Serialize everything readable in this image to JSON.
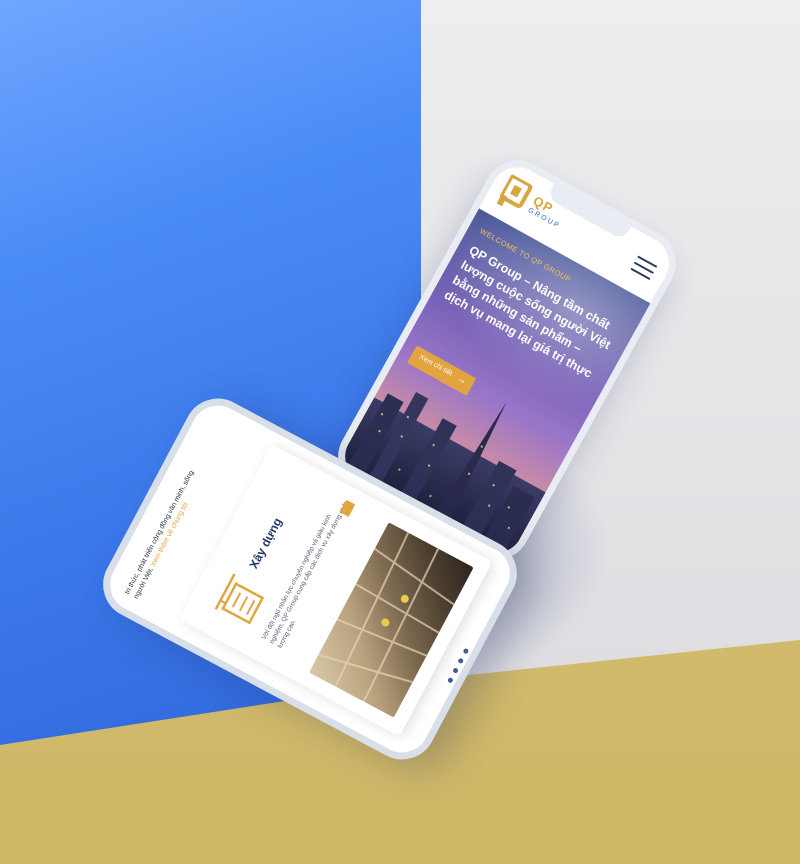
{
  "phone_top": {
    "logo": {
      "mark": "QP",
      "text": "QP",
      "sub": "GROUP"
    },
    "menu_icon": "hamburger-icon",
    "welcome": "WELCOME TO QP GROUP",
    "headline": "QP Group – Nâng tầm chất lượng cuộc sống người Việt bằng những sản phẩm – dịch vụ mang lại giá trị thực",
    "cta_label": "Xem chi tiết",
    "cta_icon": "arrow-right-icon",
    "colors": {
      "accent": "#e2a43e",
      "brand_blue": "#2e6fd7"
    }
  },
  "phone_bottom": {
    "intro_text": "tri thức, phát triển cộng đồng văn minh, sống người Việt.",
    "intro_link": "Xem thêm về chúng tôi",
    "card": {
      "icon": "crane-building-icon",
      "title": "Xây dựng",
      "description": "Với đội ngũ nhân lực chuyên nghiệp và giàu kinh nghiệm, QP Group cung cấp các dịch vụ xây dựng chất lượng cao."
    },
    "pagination_dots": 4
  }
}
